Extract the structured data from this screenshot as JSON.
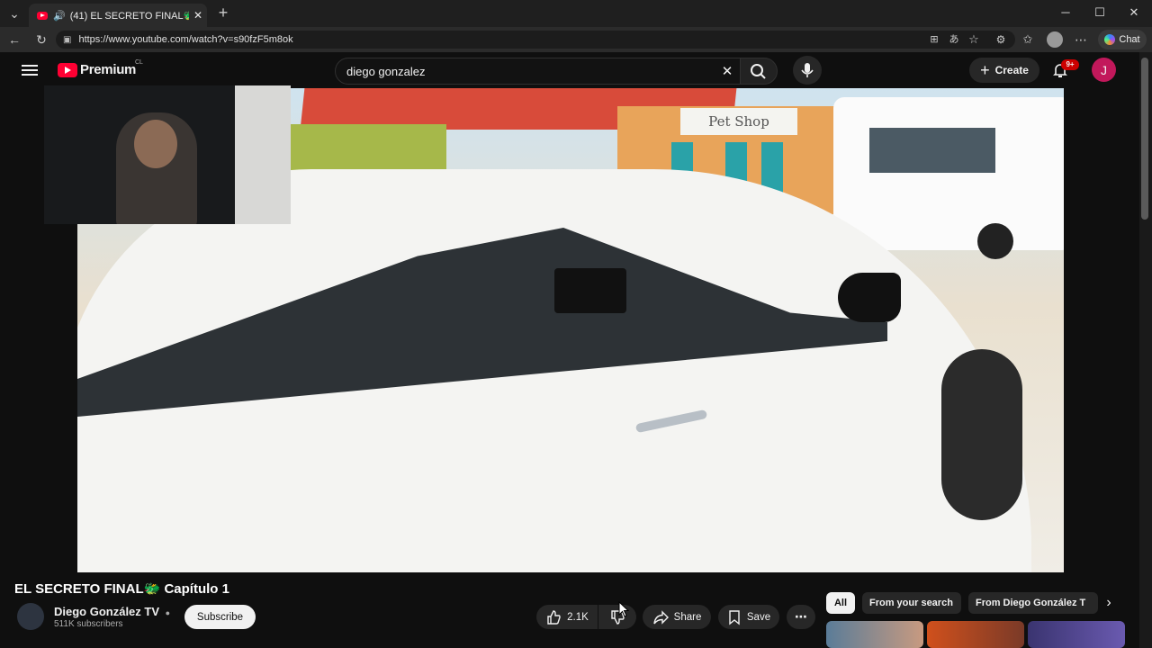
{
  "browser": {
    "tab_title": "(41) EL SECRETO FINAL🐲 Ca",
    "url": "https://www.youtube.com/watch?v=s90fzF5m8ok",
    "chat_label": "Chat"
  },
  "masthead": {
    "logo_text": "Premium",
    "region": "CL",
    "search_value": "diego gonzalez",
    "create_label": "Create",
    "notifications_count": "9+",
    "avatar_letter": "J"
  },
  "video": {
    "title": "EL SECRETO FINAL🐲 Capítulo 1",
    "shop_sign": "Pet Shop",
    "channel": {
      "name": "Diego González TV",
      "subscribers": "511K subscribers",
      "subscribe_label": "Subscribe"
    },
    "actions": {
      "likes": "2.1K",
      "share_label": "Share",
      "save_label": "Save"
    }
  },
  "chips": [
    "All",
    "From your search",
    "From Diego González T"
  ],
  "colors": {
    "accent": "#ff0033",
    "avatar": "#c2185b",
    "background": "#0f0f0f"
  }
}
